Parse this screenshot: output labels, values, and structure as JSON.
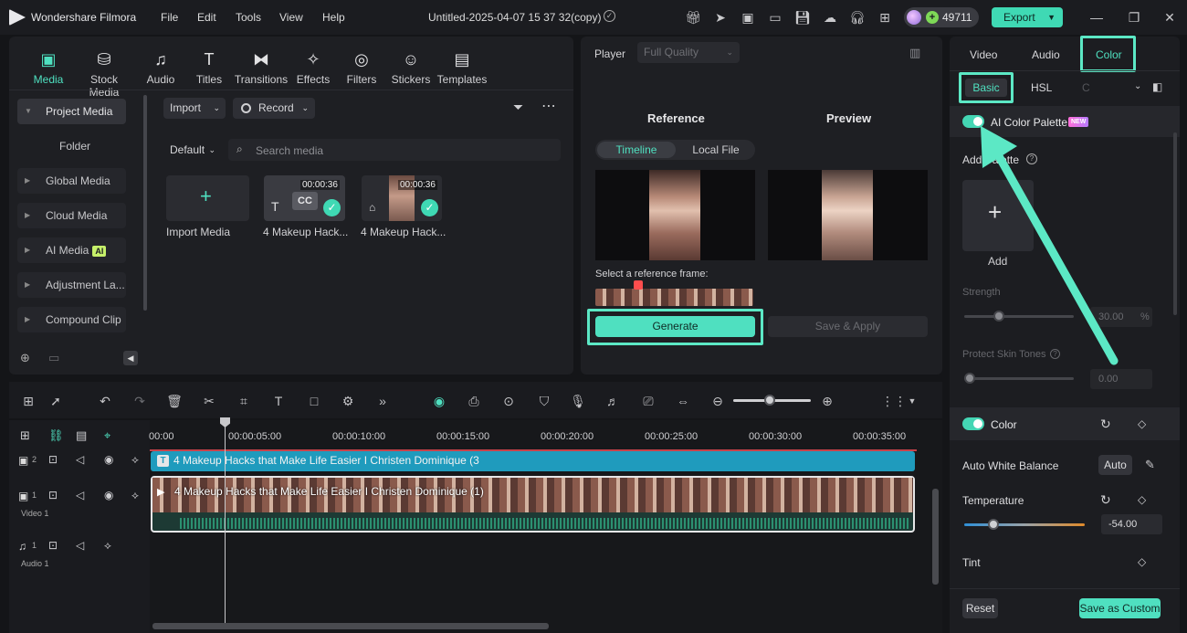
{
  "app": {
    "name": "Wondershare Filmora",
    "project_title": "Untitled-2025-04-07 15 37 32(copy)",
    "credits": "49711",
    "export_label": "Export"
  },
  "menu": [
    "File",
    "Edit",
    "Tools",
    "View",
    "Help"
  ],
  "toolbar": {
    "tabs": [
      "Media",
      "Stock Media",
      "Audio",
      "Titles",
      "Transitions",
      "Effects",
      "Filters",
      "Stickers",
      "Templates"
    ]
  },
  "sidebar": {
    "items": [
      "Project Media",
      "Folder",
      "Global Media",
      "Cloud Media",
      "AI Media",
      "Adjustment La...",
      "Compound Clip"
    ],
    "ai_badge": "AI"
  },
  "media": {
    "import_label": "Import",
    "record_label": "Record",
    "sort_label": "Default",
    "search_placeholder": "Search media",
    "items": [
      {
        "label": "Import Media"
      },
      {
        "label": "4 Makeup Hack...",
        "duration": "00:00:36",
        "badge": "CC"
      },
      {
        "label": "4 Makeup Hack...",
        "duration": "00:00:36"
      }
    ]
  },
  "player": {
    "label": "Player",
    "quality": "Full Quality",
    "reference_title": "Reference",
    "preview_title": "Preview",
    "tabs": [
      "Timeline",
      "Local File"
    ],
    "frame_prompt": "Select a reference frame:",
    "generate_label": "Generate",
    "save_apply_label": "Save & Apply"
  },
  "timeline": {
    "ruler": [
      "00:00",
      "00:00:05:00",
      "00:00:10:00",
      "00:00:15:00",
      "00:00:20:00",
      "00:00:25:00",
      "00:00:30:00",
      "00:00:35:00"
    ],
    "tracks": [
      {
        "num": "2",
        "name": "",
        "clip": "4 Makeup Hacks that Make Life Easier I Christen Dominique (3"
      },
      {
        "num": "1",
        "name": "Video 1",
        "clip": "4 Makeup Hacks that Make Life Easier I Christen Dominique (1)"
      },
      {
        "num": "1",
        "name": "Audio 1",
        "clip": ""
      }
    ]
  },
  "right_panel": {
    "tabs": [
      "Video",
      "Audio",
      "Color"
    ],
    "subtabs": [
      "Basic",
      "HSL",
      "C"
    ],
    "ai_palette": {
      "label": "AI Color Palette",
      "badge": "NEW"
    },
    "add_palette_label": "Add Palette",
    "add_label": "Add",
    "strength_label": "Strength",
    "strength_value": "30.00",
    "strength_unit": "%",
    "protect_label": "Protect Skin Tones",
    "protect_value": "0.00",
    "color_label": "Color",
    "awb_label": "Auto White Balance",
    "awb_button": "Auto",
    "temperature_label": "Temperature",
    "temperature_value": "-54.00",
    "tint_label": "Tint",
    "reset_label": "Reset",
    "save_custom_label": "Save as Custom"
  },
  "colors": {
    "accent": "#4fe0c0",
    "highlight": "#5ce8c5",
    "clip_title": "#1f9bbd"
  }
}
